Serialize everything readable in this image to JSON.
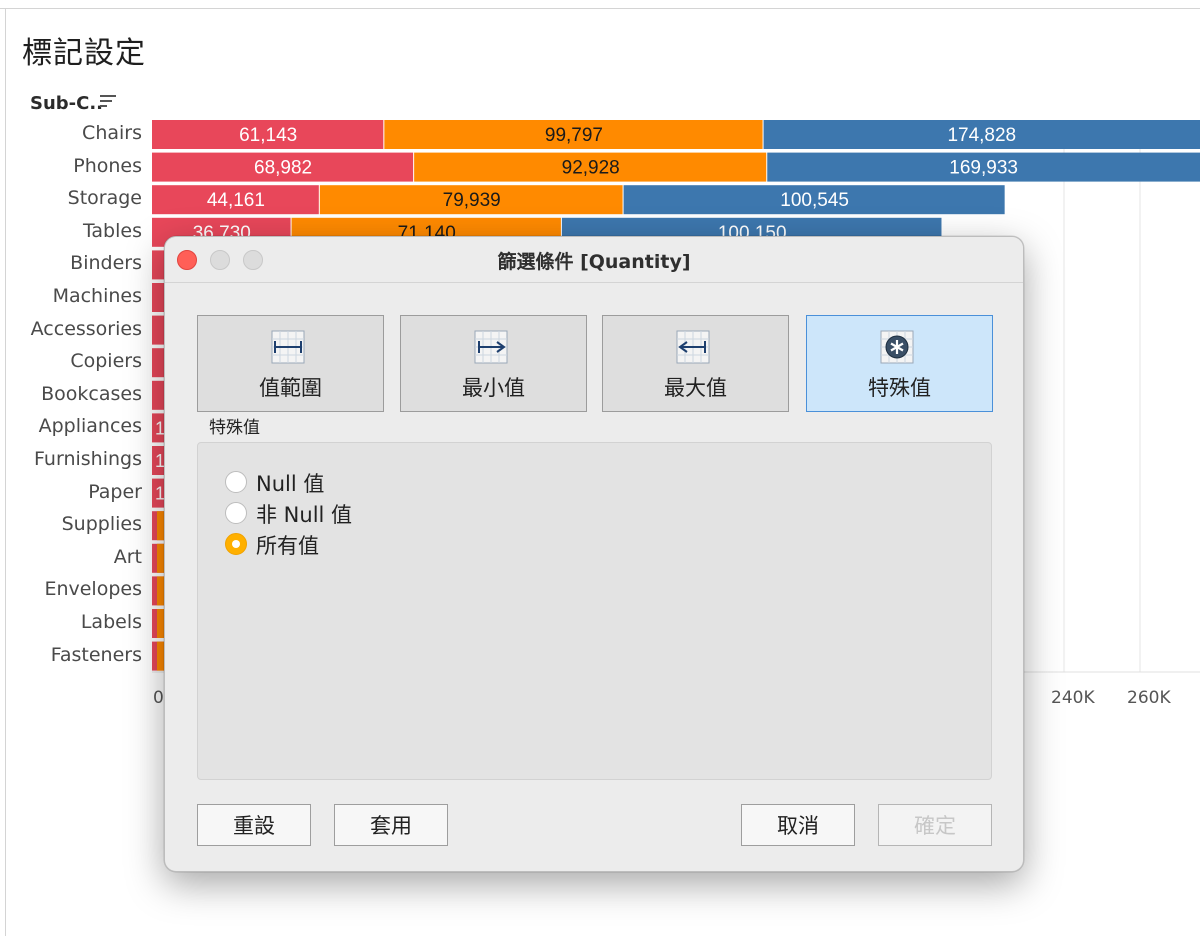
{
  "sheet": {
    "title": "標記設定",
    "column_header": "Sub-C..",
    "axis_ticks_visible": [
      "0",
      "240K",
      "260K"
    ]
  },
  "chart_data": {
    "type": "bar",
    "orientation": "horizontal",
    "stacked": true,
    "categories": [
      "Chairs",
      "Phones",
      "Storage",
      "Tables",
      "Binders",
      "Machines",
      "Accessories",
      "Copiers",
      "Bookcases",
      "Appliances",
      "Furnishings",
      "Paper",
      "Supplies",
      "Art",
      "Envelopes",
      "Labels",
      "Fasteners"
    ],
    "series": [
      {
        "color": "#e8475a",
        "values": [
          61143,
          68982,
          44161,
          36730,
          null,
          null,
          null,
          null,
          null,
          null,
          null,
          null,
          null,
          null,
          null,
          null,
          null
        ]
      },
      {
        "color": "#ff8a00",
        "values": [
          99797,
          92928,
          79939,
          71140,
          null,
          null,
          null,
          null,
          null,
          null,
          null,
          null,
          null,
          null,
          null,
          null,
          null
        ]
      },
      {
        "color": "#3d77ae",
        "values": [
          174828,
          169933,
          100545,
          100150,
          null,
          null,
          null,
          null,
          null,
          null,
          null,
          null,
          null,
          null,
          null,
          null,
          null
        ]
      }
    ],
    "data_labels": [
      [
        "61,143",
        "99,797",
        "174,828"
      ],
      [
        "68,982",
        "92,928",
        "169,933"
      ],
      [
        "44,161",
        "79,939",
        "100,545"
      ],
      [
        "36,730",
        "71,140",
        "100,150"
      ]
    ],
    "partial_glyph": "1",
    "xlim": [
      0,
      280000
    ],
    "xticks": [
      "0",
      "240K",
      "260K"
    ],
    "grid": true
  },
  "dialog": {
    "title": "篩選條件 [Quantity]",
    "tabs": [
      {
        "label": "值範圍",
        "icon": "range-icon"
      },
      {
        "label": "最小值",
        "icon": "minimum-icon"
      },
      {
        "label": "最大值",
        "icon": "maximum-icon"
      },
      {
        "label": "特殊值",
        "icon": "special-icon",
        "active": true
      }
    ],
    "section_caption": "特殊值",
    "options": [
      {
        "label": "Null 值",
        "checked": false
      },
      {
        "label": "非 Null 值",
        "checked": false
      },
      {
        "label": "所有值",
        "checked": true
      }
    ],
    "buttons": {
      "reset": "重設",
      "apply": "套用",
      "cancel": "取消",
      "ok": "確定"
    }
  }
}
